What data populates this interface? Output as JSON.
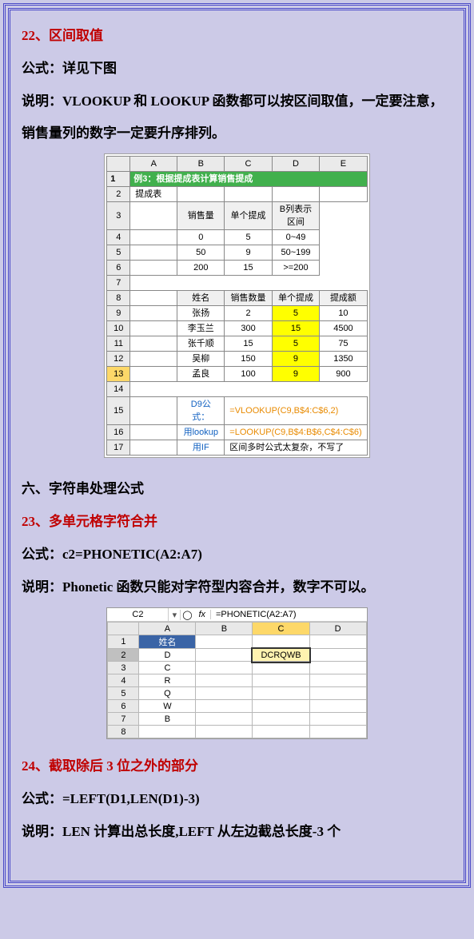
{
  "s22": {
    "title": "22、区间取值",
    "formula": "公式：详见下图",
    "desc": "说明：VLOOKUP 和 LOOKUP 函数都可以按区间取值，一定要注意，销售量列的数字一定要升序排列。"
  },
  "tbl1": {
    "caption": "例3：根据提成表计算销售提成",
    "subcap": "提成表",
    "hdr1": [
      "销售量",
      "单个提成",
      "B列表示区间"
    ],
    "rows1": [
      [
        "0",
        "5",
        "0~49"
      ],
      [
        "50",
        "9",
        "50~199"
      ],
      [
        "200",
        "15",
        ">=200"
      ]
    ],
    "hdr2": [
      "姓名",
      "销售数量",
      "单个提成",
      "提成额"
    ],
    "rows2": [
      [
        "张扬",
        "2",
        "5",
        "10"
      ],
      [
        "李玉兰",
        "300",
        "15",
        "4500"
      ],
      [
        "张千顺",
        "15",
        "5",
        "75"
      ],
      [
        "吴柳",
        "150",
        "9",
        "1350"
      ],
      [
        "孟良",
        "100",
        "9",
        "900"
      ]
    ],
    "f1lbl": "D9公式：",
    "f1": "=VLOOKUP(C9,B$4:C$6,2)",
    "f2lbl": "用lookup",
    "f2": "=LOOKUP(C9,B$4:B$6,C$4:C$6)",
    "f3lbl": "用IF",
    "f3": "区间多时公式太复杂，不写了"
  },
  "sec6": "六、字符串处理公式",
  "s23": {
    "title": "23、多单元格字符合并",
    "formula": "公式：c2=PHONETIC(A2:A7)",
    "desc": "说明：Phonetic 函数只能对字符型内容合并，数字不可以。"
  },
  "tbl2": {
    "cellref": "C2",
    "formula": "=PHONETIC(A2:A7)",
    "header": "姓名",
    "colA": [
      "D",
      "C",
      "R",
      "Q",
      "W",
      "B"
    ],
    "result": "DCRQWB"
  },
  "s24": {
    "title": "24、截取除后 3 位之外的部分",
    "formula": "公式：=LEFT(D1,LEN(D1)-3)",
    "desc": "说明：LEN 计算出总长度,LEFT 从左边截总长度-3 个"
  }
}
